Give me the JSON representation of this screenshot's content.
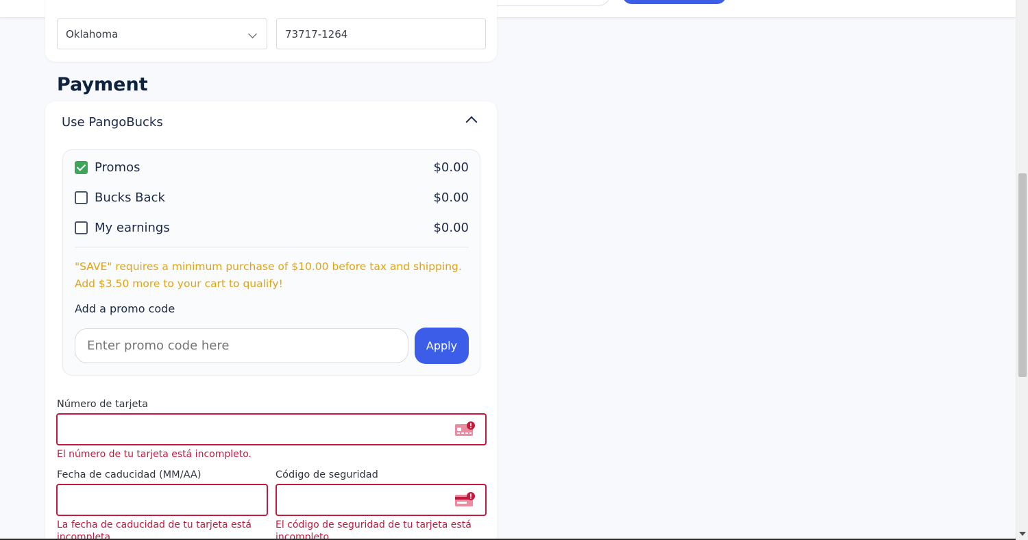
{
  "address": {
    "state_value": "Oklahoma",
    "zip_value": "73717-1264"
  },
  "payment": {
    "title": "Payment",
    "pangobucks": {
      "header": "Use PangoBucks",
      "items": [
        {
          "label": "Promos",
          "amount": "$0.00",
          "checked": true
        },
        {
          "label": "Bucks Back",
          "amount": "$0.00",
          "checked": false
        },
        {
          "label": "My earnings",
          "amount": "$0.00",
          "checked": false
        }
      ],
      "warning_line1": "\"SAVE\" requires a minimum purchase of $10.00 before tax and shipping.",
      "warning_line2": "Add $3.50 more to your cart to qualify!",
      "promo_label": "Add a promo code",
      "promo_placeholder": "Enter promo code here",
      "apply_label": "Apply"
    },
    "card": {
      "number_label": "Número de tarjeta",
      "number_error": "El número de tu tarjeta está incompleto.",
      "expiry_label": "Fecha de caducidad (MM/AA)",
      "expiry_error": "La fecha de caducidad de tu tarjeta está incompleta.",
      "cvc_label": "Código de seguridad",
      "cvc_error": "El código de seguridad de tu tarjeta está incompleto."
    }
  },
  "colors": {
    "accent": "#3b5de7",
    "error": "#c4193c",
    "warning": "#e0a312",
    "check": "#3ea55b"
  }
}
